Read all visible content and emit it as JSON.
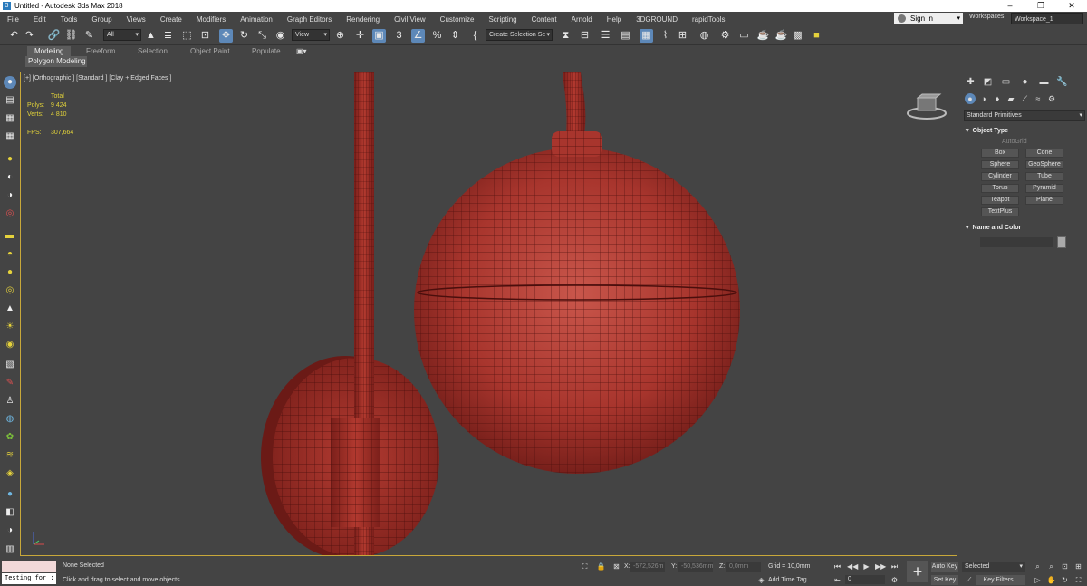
{
  "window": {
    "title": "Untitled - Autodesk 3ds Max 2018",
    "controls": [
      "–",
      "❐",
      "✕"
    ]
  },
  "menu": [
    "File",
    "Edit",
    "Tools",
    "Group",
    "Views",
    "Create",
    "Modifiers",
    "Animation",
    "Graph Editors",
    "Rendering",
    "Civil View",
    "Customize",
    "Scripting",
    "Content",
    "Arnold",
    "Help",
    "3DGROUND",
    "rapidTools"
  ],
  "account": {
    "sign_in": "Sign In",
    "workspaces_label": "Workspaces:",
    "workspace": "Workspace_1"
  },
  "toolbar": {
    "selection_filter": "All",
    "reference_coord": "View",
    "named_selection": "Create Selection Se",
    "angle_snap_label": "3"
  },
  "ribbon": {
    "tabs": [
      "Modeling",
      "Freeform",
      "Selection",
      "Object Paint",
      "Populate"
    ],
    "sub_tab": "Polygon Modeling"
  },
  "viewport": {
    "label": "[+] [Orthographic ] [Standard ] [Clay + Edged Faces ]",
    "stats": {
      "total_label": "Total",
      "polys_label": "Polys:",
      "polys": "9 424",
      "verts_label": "Verts:",
      "verts": "4 810",
      "fps_label": "FPS:",
      "fps": "307,664"
    }
  },
  "command_panel": {
    "category": "Standard Primitives",
    "object_type_title": "Object Type",
    "autogrid": "AutoGrid",
    "buttons": [
      "Box",
      "Cone",
      "Sphere",
      "GeoSphere",
      "Cylinder",
      "Tube",
      "Torus",
      "Pyramid",
      "Teapot",
      "Plane",
      "TextPlus"
    ],
    "name_color_title": "Name and Color"
  },
  "status": {
    "maxscript_text": "Testing for :",
    "selection": "None Selected",
    "prompt": "Click and drag to select and move objects",
    "x_label": "X:",
    "x": "-572,526m",
    "y_label": "Y:",
    "y": "-50,536mm",
    "z_label": "Z:",
    "z": "0,0mm",
    "grid": "Grid = 10,0mm",
    "add_time_tag": "Add Time Tag",
    "frame": "0",
    "auto_key": "Auto Key",
    "set_key": "Set Key",
    "selected": "Selected",
    "key_filters": "Key Filters..."
  },
  "colors": {
    "accent": "#5d88b8",
    "viewport_border": "#c8a83a",
    "stats_text": "#e2d23a",
    "mesh": "#b03a30",
    "wire": "#4a0e0c"
  }
}
